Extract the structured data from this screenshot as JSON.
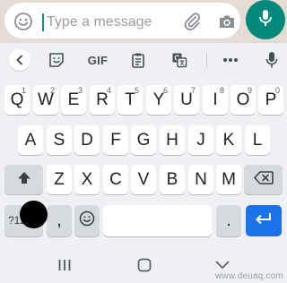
{
  "colors": {
    "chat_background": "#e5ddd5",
    "accent": "#00897b",
    "enter_key": "#1a73e8",
    "keyboard_background": "#eef0f3"
  },
  "chat_input": {
    "placeholder": "Type a message",
    "left_icon": "emoji-icon",
    "right_icons": [
      "paperclip-icon",
      "camera-icon"
    ],
    "send_action_icon": "microphone-icon"
  },
  "keyboard": {
    "toolbar": {
      "items": [
        "chevron-left-icon",
        "sticker-icon",
        "GIF",
        "clipboard-icon",
        "translate-icon",
        "more-icon",
        "microphone-icon"
      ],
      "gif_label": "GIF"
    },
    "row1": [
      {
        "label": "Q",
        "hint": "1"
      },
      {
        "label": "W",
        "hint": "2"
      },
      {
        "label": "E",
        "hint": "3"
      },
      {
        "label": "R",
        "hint": "4"
      },
      {
        "label": "T",
        "hint": "5"
      },
      {
        "label": "Y",
        "hint": "6"
      },
      {
        "label": "U",
        "hint": "7"
      },
      {
        "label": "I",
        "hint": "8"
      },
      {
        "label": "O",
        "hint": "9"
      },
      {
        "label": "P",
        "hint": "0"
      }
    ],
    "row2": [
      "A",
      "S",
      "D",
      "F",
      "G",
      "H",
      "J",
      "K",
      "L"
    ],
    "row3": [
      "Z",
      "X",
      "C",
      "V",
      "B",
      "N",
      "M"
    ],
    "row3_icons": [
      "shift-icon",
      "backspace-icon"
    ],
    "bottom_row": {
      "symbols_label": "?123",
      "comma_label": ",",
      "emoji_icon": "emoji-icon",
      "period_label": ".",
      "enter_icon": "enter-arrow-icon"
    }
  },
  "nav_bar": {
    "items": [
      "recents-icon",
      "home-icon",
      "back-chevron-icon"
    ],
    "watermark": "www.deuaq.com"
  }
}
